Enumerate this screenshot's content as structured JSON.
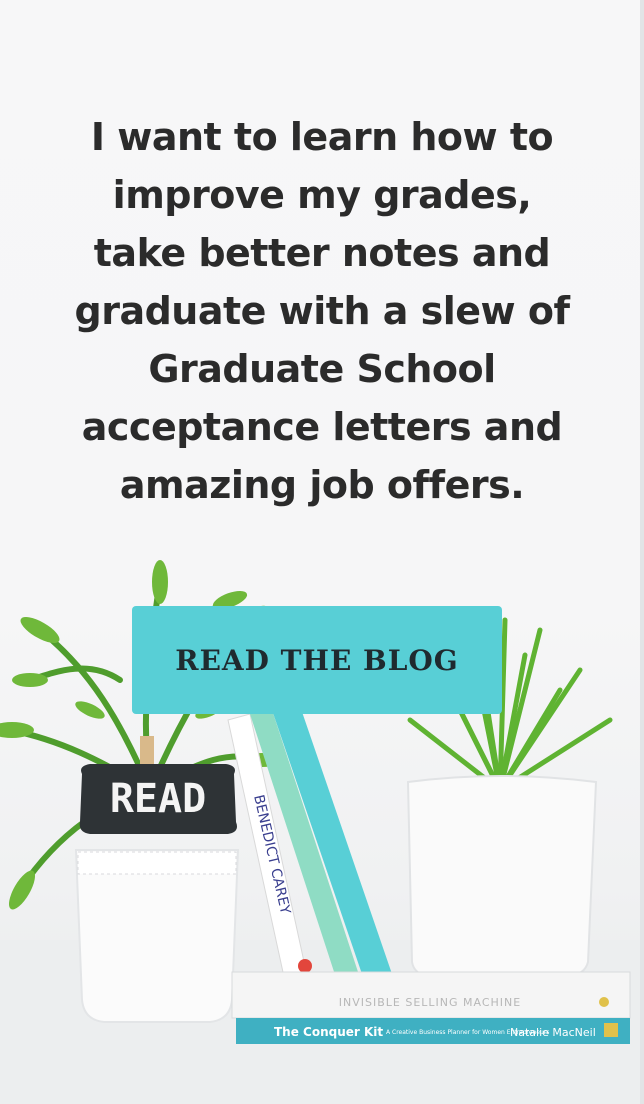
{
  "hero": {
    "headline": "I want to learn how to improve my grades, take better notes and graduate with a slew of Graduate School acceptance letters and amazing job offers.",
    "cta_label": "READ THE BLOG",
    "sign_text": "READ",
    "book_spine_author": "BENEDICT CAREY",
    "book_top_title": "INVISIBLE SELLING MACHINE",
    "book_bottom_title": "The Conquer Kit",
    "book_bottom_subtitle": "A Creative Business Planner for Women Entrepreneurs",
    "book_bottom_author": "Natalie MacNeil"
  },
  "colors": {
    "accent": "#58cfd6",
    "text": "#2b2b2b",
    "button_text": "#1f2a2f"
  }
}
